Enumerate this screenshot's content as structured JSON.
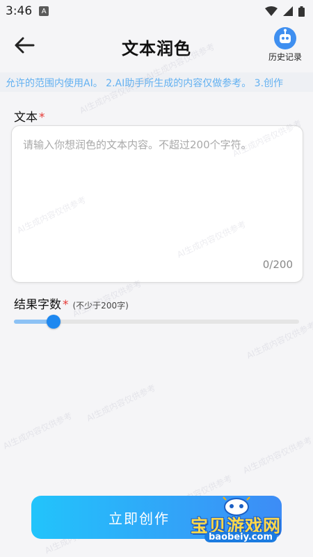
{
  "status_bar": {
    "time": "3:46",
    "notification_letter": "A"
  },
  "header": {
    "title": "文本润色",
    "history_label": "历史记录",
    "back_icon": "arrow-left-icon",
    "history_icon": "robot-icon"
  },
  "notice": {
    "text": "允许的范围内使用AI。 2.AI助手所生成的内容仅做参考。 3.创作"
  },
  "text_field": {
    "label": "文本",
    "required_mark": "*",
    "placeholder": "请输入你想润色的文本内容。不超过200个字符。",
    "value": "",
    "counter": "0/200"
  },
  "result_count": {
    "label": "结果字数",
    "required_mark": "*",
    "hint": "(不少于200字)",
    "slider_fraction": 0.14
  },
  "watermark": {
    "text": "AI生成内容仅供参考"
  },
  "create_button": {
    "label": "立即创作"
  },
  "logo": {
    "cn_text": "宝贝游戏网",
    "url": "baobeiy.com"
  },
  "colors": {
    "accent": "#1e88f0",
    "button_start": "#22c4fb",
    "button_end": "#3d8cf6",
    "required": "#e53935",
    "notice_text": "#63b1f1"
  }
}
